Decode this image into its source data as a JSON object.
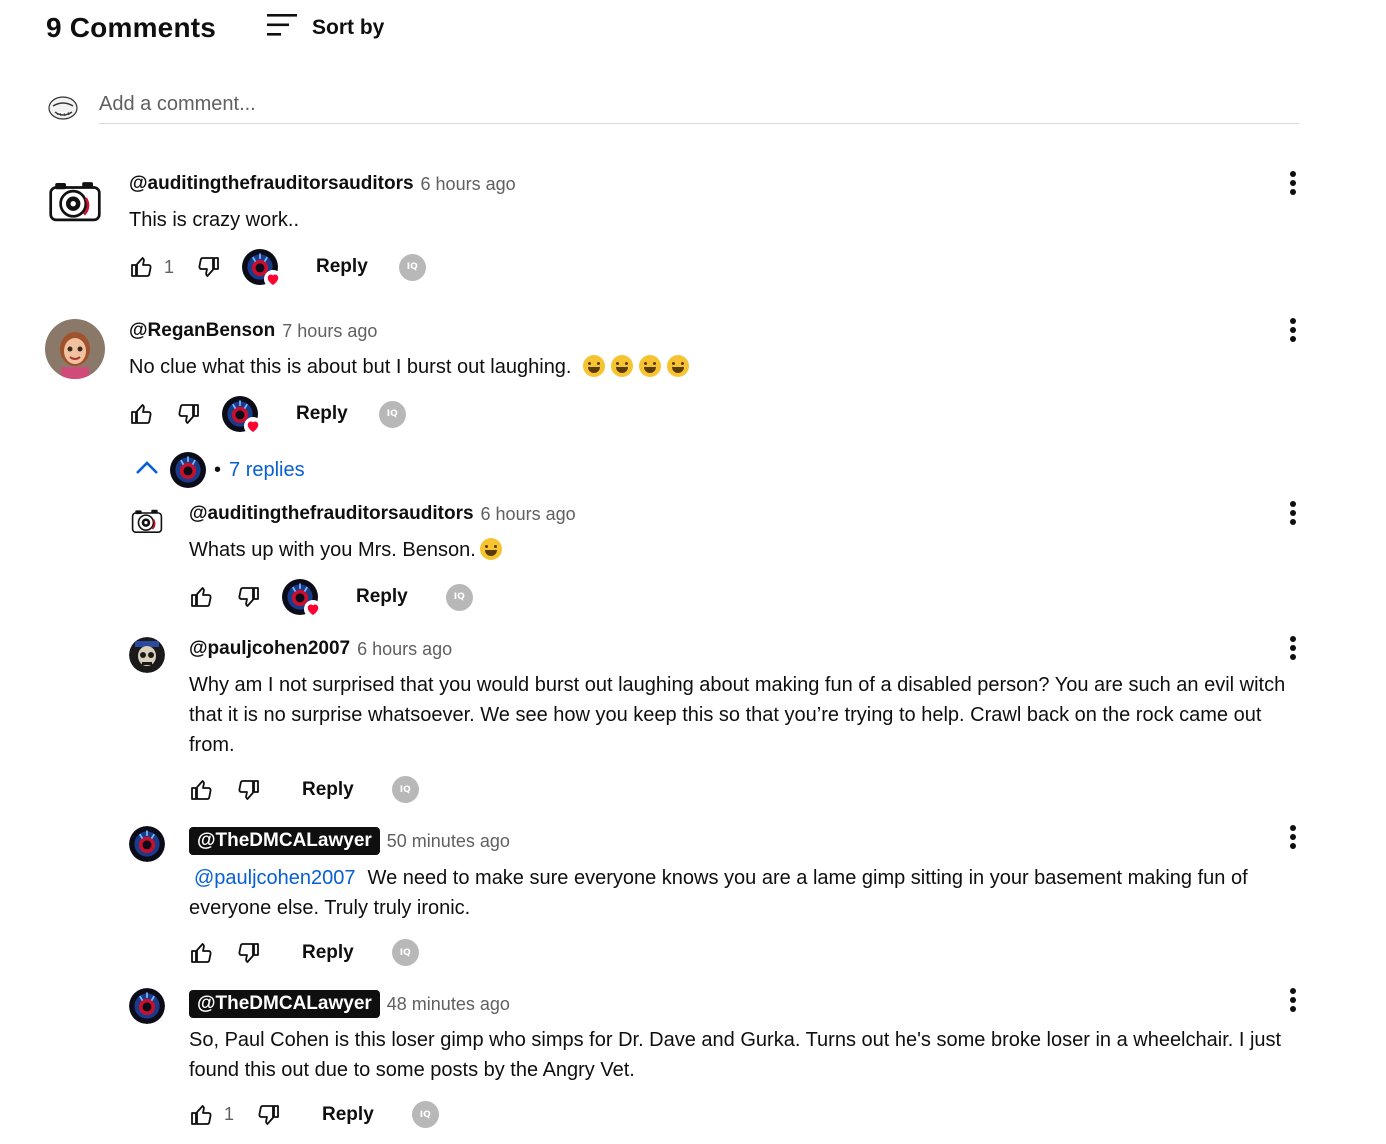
{
  "header": {
    "comment_count": "9 Comments",
    "sort_label": "Sort by"
  },
  "add_comment": {
    "placeholder": "Add a comment..."
  },
  "comments": [
    {
      "author": "@auditingthefrauditorsauditors",
      "time": "6 hours ago",
      "text": "This is crazy work..",
      "likes": "1",
      "reply_label": "Reply"
    },
    {
      "author": "@ReganBenson",
      "time": "7 hours ago",
      "text": "No clue what this is about but I burst out laughing. ",
      "likes": "",
      "reply_label": "Reply",
      "replies_label": "7 replies"
    }
  ],
  "replies": [
    {
      "author": "@auditingthefrauditorsauditors",
      "time": "6 hours ago",
      "text": "Whats up with you Mrs. Benson.",
      "reply_label": "Reply"
    },
    {
      "author": "@pauljcohen2007",
      "time": "6 hours ago",
      "text": "Why am I not surprised that you would burst out laughing about making fun of a disabled person? You are such an evil witch that it is no surprise whatsoever. We see how you keep this so that you’re trying to help. Crawl back on the rock came out from.",
      "reply_label": "Reply"
    },
    {
      "author": "@TheDMCALawyer",
      "time": "50 minutes ago",
      "mention": "@pauljcohen2007",
      "text": "We need to make sure everyone knows you are a lame gimp sitting in your basement making fun of everyone else. Truly truly ironic.",
      "reply_label": "Reply"
    },
    {
      "author": "@TheDMCALawyer",
      "time": "48 minutes ago",
      "text": "So, Paul Cohen is this loser gimp who simps for Dr. Dave and Gurka. Turns out he's some broke loser in a wheelchair. I just found this out due to some posts by the Angry Vet.",
      "likes": "1",
      "reply_label": "Reply"
    }
  ],
  "icons": {
    "sort": "sort-icon",
    "like": "thumbs-up-icon",
    "dislike": "thumbs-down-icon",
    "more": "more-vertical-icon",
    "heart": "heart-icon",
    "chevron": "chevron-up-icon",
    "iq": "IQ"
  },
  "colors": {
    "link": "#065fd4",
    "heart": "#ff0033",
    "muted": "#606060"
  }
}
